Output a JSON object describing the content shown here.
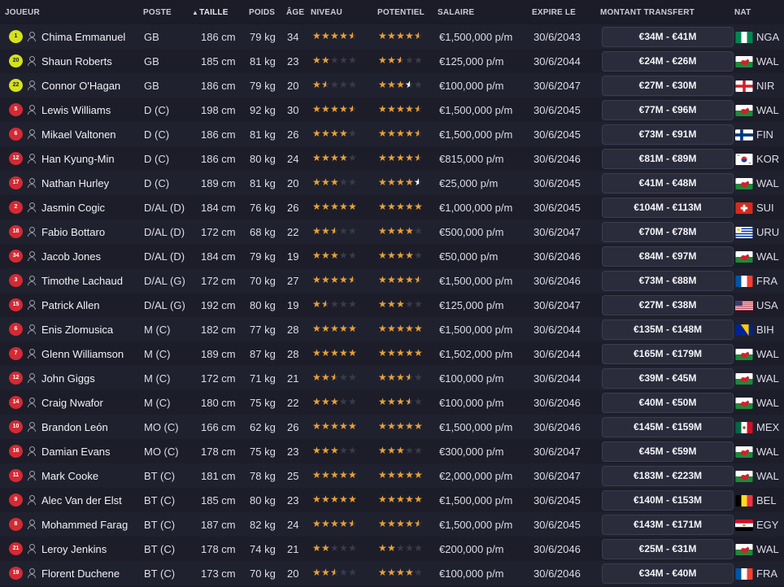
{
  "columns": {
    "player": "JOUEUR",
    "position": "POSTE",
    "height": "TAILLE",
    "weight": "POIDS",
    "age": "ÂGE",
    "level": "NIVEAU",
    "potential": "POTENTIEL",
    "salary": "SALAIRE",
    "expiry": "EXPIRE LE",
    "transfer_value": "MONTANT TRANSFERT",
    "nationality": "NAT"
  },
  "sort": {
    "column": "height",
    "arrow": "▲"
  },
  "players": [
    {
      "number": "1",
      "name": "Chima Emmanuel",
      "position": "GB",
      "height": "186 cm",
      "weight": "79 kg",
      "age": "34",
      "level": 4.5,
      "potential": 4.5,
      "salary": "€1,500,000 p/m",
      "expiry": "30/6/2043",
      "transfer_value": "€34M - €41M",
      "nation": "NGA",
      "flag": "nga",
      "gk": true
    },
    {
      "number": "20",
      "name": "Shaun Roberts",
      "position": "GB",
      "height": "185 cm",
      "weight": "81 kg",
      "age": "23",
      "level": 2,
      "potential": 2.5,
      "salary": "€125,000 p/m",
      "expiry": "30/6/2044",
      "transfer_value": "€24M - €26M",
      "nation": "WAL",
      "flag": "wal",
      "gk": true
    },
    {
      "number": "22",
      "name": "Connor O'Hagan",
      "position": "GB",
      "height": "186 cm",
      "weight": "79 kg",
      "age": "20",
      "level": 1.5,
      "potential": 3.5,
      "salary": "€100,000 p/m",
      "expiry": "30/6/2047",
      "transfer_value": "€27M - €30M",
      "nation": "NIR",
      "flag": "nir",
      "gk": true
    },
    {
      "number": "5",
      "name": "Lewis Williams",
      "position": "D (C)",
      "height": "198 cm",
      "weight": "92 kg",
      "age": "30",
      "level": 4.5,
      "potential": 4.5,
      "salary": "€1,500,000 p/m",
      "expiry": "30/6/2045",
      "transfer_value": "€77M - €96M",
      "nation": "WAL",
      "flag": "wal"
    },
    {
      "number": "6",
      "name": "Mikael Valtonen",
      "position": "D (C)",
      "height": "186 cm",
      "weight": "81 kg",
      "age": "26",
      "level": 4,
      "potential": 4.5,
      "salary": "€1,500,000 p/m",
      "expiry": "30/6/2045",
      "transfer_value": "€73M - €91M",
      "nation": "FIN",
      "flag": "fin"
    },
    {
      "number": "12",
      "name": "Han Kyung-Min",
      "position": "D (C)",
      "height": "186 cm",
      "weight": "80 kg",
      "age": "24",
      "level": 4,
      "potential": 4.5,
      "salary": "€815,000 p/m",
      "expiry": "30/6/2046",
      "transfer_value": "€81M - €89M",
      "nation": "KOR",
      "flag": "kor"
    },
    {
      "number": "17",
      "name": "Nathan Hurley",
      "position": "D (C)",
      "height": "189 cm",
      "weight": "81 kg",
      "age": "20",
      "level": 3,
      "potential": 4.5,
      "salary": "€25,000 p/m",
      "expiry": "30/6/2045",
      "transfer_value": "€41M - €48M",
      "nation": "WAL",
      "flag": "wal"
    },
    {
      "number": "2",
      "name": "Jasmin Cogic",
      "position": "D/AL (D)",
      "height": "184 cm",
      "weight": "76 kg",
      "age": "26",
      "level": 5,
      "potential": 5,
      "salary": "€1,000,000 p/m",
      "expiry": "30/6/2045",
      "transfer_value": "€104M - €113M",
      "nation": "SUI",
      "flag": "sui"
    },
    {
      "number": "18",
      "name": "Fabio Bottaro",
      "position": "D/AL (D)",
      "height": "172 cm",
      "weight": "68 kg",
      "age": "22",
      "level": 2.5,
      "potential": 4,
      "salary": "€500,000 p/m",
      "expiry": "30/6/2047",
      "transfer_value": "€70M - €78M",
      "nation": "URU",
      "flag": "uru"
    },
    {
      "number": "34",
      "name": "Jacob Jones",
      "position": "D/AL (D)",
      "height": "184 cm",
      "weight": "79 kg",
      "age": "19",
      "level": 3,
      "potential": 4,
      "salary": "€50,000 p/m",
      "expiry": "30/6/2046",
      "transfer_value": "€84M - €97M",
      "nation": "WAL",
      "flag": "wal"
    },
    {
      "number": "3",
      "name": "Timothe Lachaud",
      "position": "D/AL (G)",
      "height": "172 cm",
      "weight": "70 kg",
      "age": "27",
      "level": 4.5,
      "potential": 4.5,
      "salary": "€1,500,000 p/m",
      "expiry": "30/6/2046",
      "transfer_value": "€73M - €88M",
      "nation": "FRA",
      "flag": "fra"
    },
    {
      "number": "15",
      "name": "Patrick Allen",
      "position": "D/AL (G)",
      "height": "192 cm",
      "weight": "80 kg",
      "age": "19",
      "level": 1.5,
      "potential": 3,
      "salary": "€125,000 p/m",
      "expiry": "30/6/2047",
      "transfer_value": "€27M - €38M",
      "nation": "USA",
      "flag": "usa"
    },
    {
      "number": "6",
      "name": "Enis Zlomusica",
      "position": "M (C)",
      "height": "182 cm",
      "weight": "77 kg",
      "age": "28",
      "level": 5,
      "potential": 5,
      "salary": "€1,500,000 p/m",
      "expiry": "30/6/2044",
      "transfer_value": "€135M - €148M",
      "nation": "BIH",
      "flag": "bih"
    },
    {
      "number": "7",
      "name": "Glenn Williamson",
      "position": "M (C)",
      "height": "189 cm",
      "weight": "87 kg",
      "age": "28",
      "level": 5,
      "potential": 5,
      "salary": "€1,502,000 p/m",
      "expiry": "30/6/2044",
      "transfer_value": "€165M - €179M",
      "nation": "WAL",
      "flag": "wal"
    },
    {
      "number": "12",
      "name": "John Giggs",
      "position": "M (C)",
      "height": "172 cm",
      "weight": "71 kg",
      "age": "21",
      "level": 2.5,
      "potential": 3.5,
      "salary": "€100,000 p/m",
      "expiry": "30/6/2044",
      "transfer_value": "€39M - €45M",
      "nation": "WAL",
      "flag": "wal"
    },
    {
      "number": "14",
      "name": "Craig Nwafor",
      "position": "M (C)",
      "height": "180 cm",
      "weight": "75 kg",
      "age": "22",
      "level": 3,
      "potential": 3.5,
      "salary": "€100,000 p/m",
      "expiry": "30/6/2046",
      "transfer_value": "€40M - €50M",
      "nation": "WAL",
      "flag": "wal"
    },
    {
      "number": "10",
      "name": "Brandon León",
      "position": "MO (C)",
      "height": "166 cm",
      "weight": "62 kg",
      "age": "26",
      "level": 5,
      "potential": 5,
      "salary": "€1,500,000 p/m",
      "expiry": "30/6/2046",
      "transfer_value": "€145M - €159M",
      "nation": "MEX",
      "flag": "mex"
    },
    {
      "number": "16",
      "name": "Damian Evans",
      "position": "MO (C)",
      "height": "178 cm",
      "weight": "75 kg",
      "age": "23",
      "level": 3,
      "potential": 3,
      "salary": "€300,000 p/m",
      "expiry": "30/6/2047",
      "transfer_value": "€45M - €59M",
      "nation": "WAL",
      "flag": "wal"
    },
    {
      "number": "11",
      "name": "Mark Cooke",
      "position": "BT (C)",
      "height": "181 cm",
      "weight": "78 kg",
      "age": "25",
      "level": 5,
      "potential": 5,
      "salary": "€2,000,000 p/m",
      "expiry": "30/6/2047",
      "transfer_value": "€183M - €223M",
      "nation": "WAL",
      "flag": "wal"
    },
    {
      "number": "9",
      "name": "Alec Van der Elst",
      "position": "BT (C)",
      "height": "185 cm",
      "weight": "80 kg",
      "age": "23",
      "level": 5,
      "potential": 5,
      "salary": "€1,500,000 p/m",
      "expiry": "30/6/2045",
      "transfer_value": "€140M - €153M",
      "nation": "BEL",
      "flag": "bel"
    },
    {
      "number": "8",
      "name": "Mohammed Farag",
      "position": "BT (C)",
      "height": "187 cm",
      "weight": "82 kg",
      "age": "24",
      "level": 4.5,
      "potential": 4.5,
      "salary": "€1,500,000 p/m",
      "expiry": "30/6/2045",
      "transfer_value": "€143M - €171M",
      "nation": "EGY",
      "flag": "egy"
    },
    {
      "number": "21",
      "name": "Leroy Jenkins",
      "position": "BT (C)",
      "height": "178 cm",
      "weight": "74 kg",
      "age": "21",
      "level": 2,
      "potential": 2,
      "salary": "€200,000 p/m",
      "expiry": "30/6/2046",
      "transfer_value": "€25M - €31M",
      "nation": "WAL",
      "flag": "wal"
    },
    {
      "number": "19",
      "name": "Florent Duchene",
      "position": "BT (C)",
      "height": "173 cm",
      "weight": "70 kg",
      "age": "20",
      "level": 2.5,
      "potential": 4,
      "salary": "€100,000 p/m",
      "expiry": "30/6/2046",
      "transfer_value": "€34M - €40M",
      "nation": "FRA",
      "flag": "fra"
    }
  ],
  "colors": {
    "background": "#1b1c28",
    "row_alt": "#20212e",
    "star": "#e8a13a",
    "star_empty": "#3a3b4a",
    "shirt": "#d42a34",
    "shirt_gk": "#d4e21c"
  }
}
